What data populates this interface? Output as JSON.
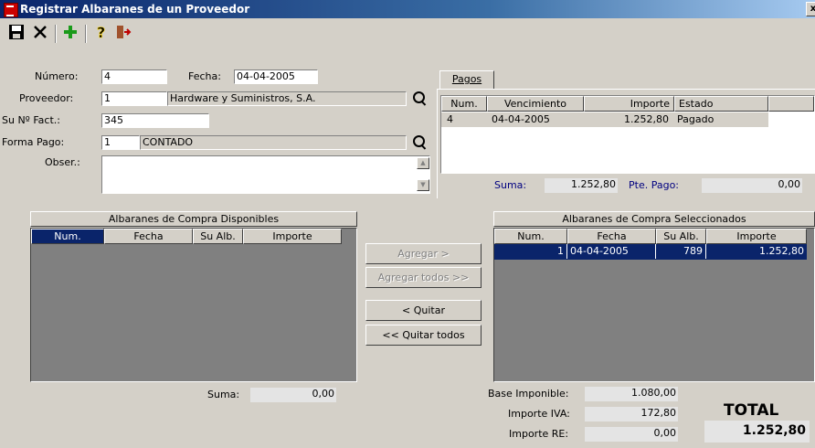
{
  "window": {
    "title": "Registrar Albaranes de un Proveedor",
    "close_glyph": "x"
  },
  "toolbar": {
    "save_icon": "save-icon",
    "cancel_icon": "cancel-icon",
    "add_icon": "add-icon",
    "help_icon": "help-icon",
    "exit_icon": "exit-icon"
  },
  "form": {
    "numero_label": "Número:",
    "numero_value": "4",
    "fecha_label": "Fecha:",
    "fecha_value": "04-04-2005",
    "proveedor_label": "Proveedor:",
    "proveedor_code": "1",
    "proveedor_name": "Hardware y Suministros, S.A.",
    "sufact_label": "Su Nº Fact.:",
    "sufact_value": "345",
    "formapago_label": "Forma Pago:",
    "formapago_code": "1",
    "formapago_name": "CONTADO",
    "obser_label": "Obser.:",
    "obser_value": ""
  },
  "pagos": {
    "tab_label": "Pagos",
    "columns": [
      "Num.",
      "Vencimiento",
      "Importe",
      "Estado",
      ""
    ],
    "rows": [
      {
        "num": "4",
        "vencimiento": "04-04-2005",
        "importe": "1.252,80",
        "estado": "Pagado"
      }
    ],
    "suma_label": "Suma:",
    "suma_value": "1.252,80",
    "pte_label": "Pte. Pago:",
    "pte_value": "0,00"
  },
  "disponibles": {
    "caption": "Albaranes de Compra Disponibles",
    "columns": [
      "Num.",
      "Fecha",
      "Su Alb.",
      "Importe"
    ],
    "rows": [],
    "suma_label": "Suma:",
    "suma_value": "0,00"
  },
  "buttons": {
    "agregar": "Agregar >",
    "agregar_todos": "Agregar todos >>",
    "quitar": "< Quitar",
    "quitar_todos": "<< Quitar todos"
  },
  "seleccionados": {
    "caption": "Albaranes de Compra Seleccionados",
    "columns": [
      "Num.",
      "Fecha",
      "Su Alb.",
      "Importe"
    ],
    "rows": [
      {
        "num": "1",
        "fecha": "04-04-2005",
        "sualb": "789",
        "importe": "1.252,80"
      }
    ]
  },
  "totals": {
    "base_label": "Base Imponible:",
    "base_value": "1.080,00",
    "iva_label": "Importe IVA:",
    "iva_value": "172,80",
    "re_label": "Importe RE:",
    "re_value": "0,00",
    "total_label": "TOTAL",
    "total_value": "1.252,80"
  },
  "colors": {
    "selection": "#0a246a",
    "face": "#d4d0c8",
    "link_blue": "#000080"
  }
}
